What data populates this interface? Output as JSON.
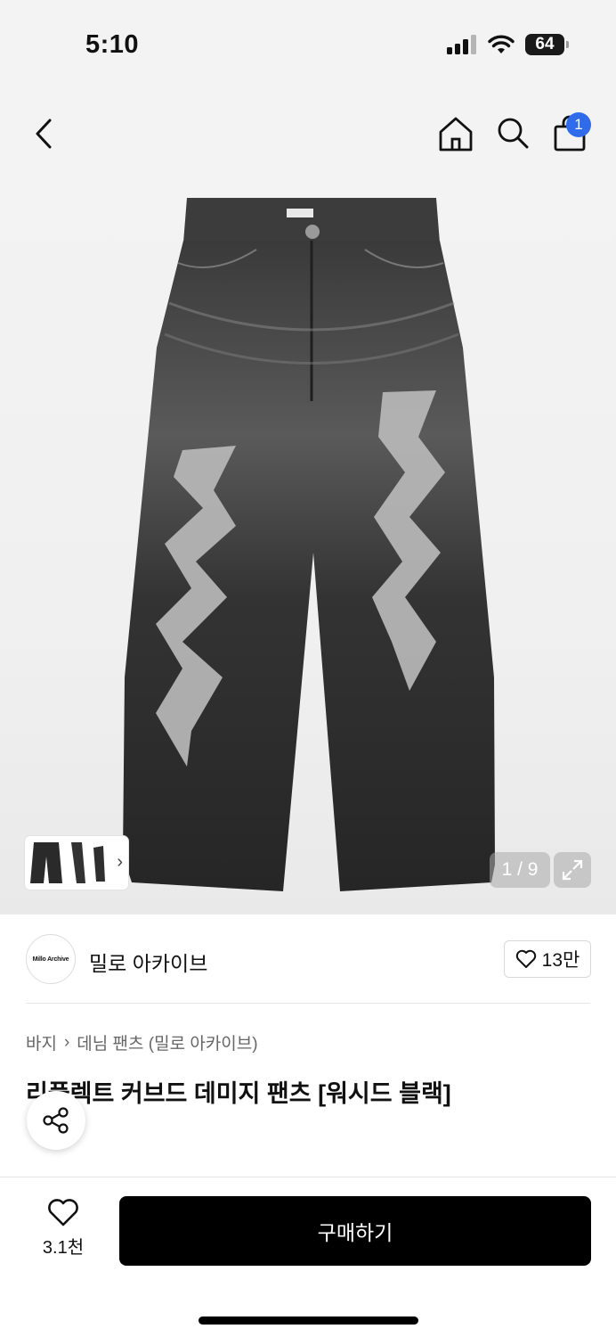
{
  "status_bar": {
    "time": "5:10",
    "battery": "64"
  },
  "nav": {
    "cart_count": "1"
  },
  "gallery": {
    "counter": "1 / 9"
  },
  "brand": {
    "logo_text": "Millo Archive",
    "name": "밀로 아카이브",
    "likes": "13만"
  },
  "breadcrumb": {
    "level1": "바지",
    "level2": "데님 팬츠 (밀로 아카이브)"
  },
  "product": {
    "title": "리플렉트 커브드 데미지 팬츠 [워시드 블랙]"
  },
  "bottom_bar": {
    "wish_count": "3.1천",
    "buy_label": "구매하기"
  }
}
